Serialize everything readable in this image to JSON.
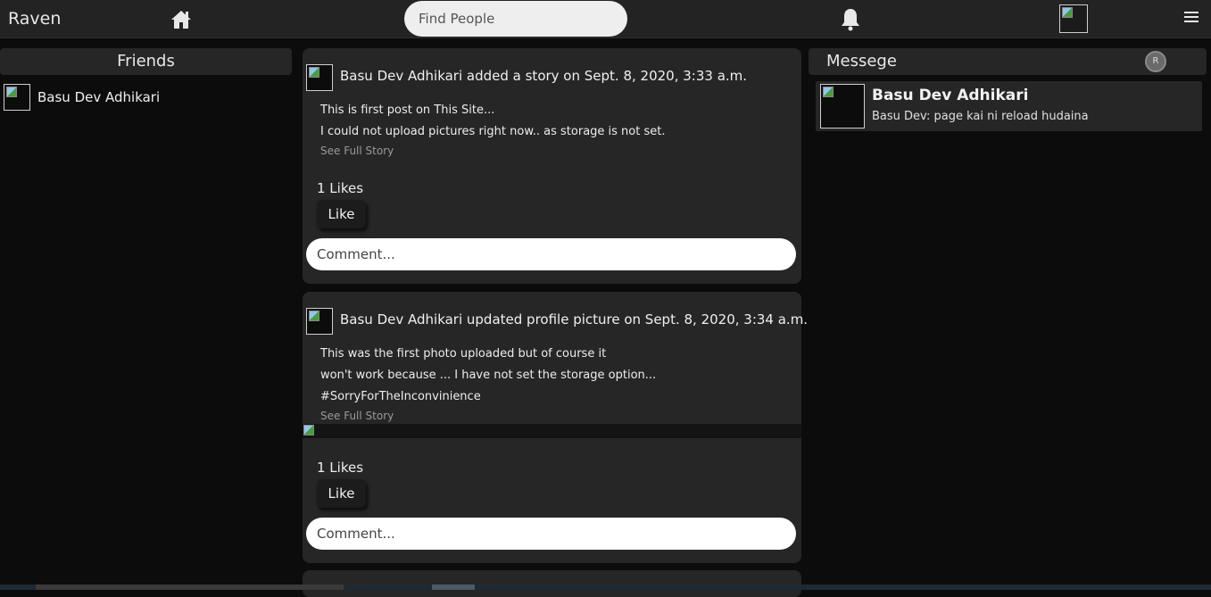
{
  "app": {
    "brand": "Raven"
  },
  "topbar": {
    "search_placeholder": "Find People",
    "icons": [
      "home-icon",
      "bell-icon",
      "menu-icon"
    ]
  },
  "friends": {
    "title": "Friends",
    "items": [
      {
        "name": "Basu Dev Adhikari"
      }
    ]
  },
  "messages": {
    "title": "Messege",
    "items": [
      {
        "name": "Basu Dev Adhikari",
        "preview": "Basu Dev: page kai ni reload hudaina"
      }
    ]
  },
  "posts": [
    {
      "title": "Basu Dev Adhikari added a story on Sept. 8, 2020, 3:33 a.m.",
      "lines": [
        "This is first post on This Site...",
        "I could not upload pictures right now.. as storage is not set."
      ],
      "see_full": "See Full Story",
      "likes": "1 Likes",
      "like_label": "Like",
      "comment_placeholder": "Comment..."
    },
    {
      "title": "Basu Dev Adhikari updated profile picture on Sept. 8, 2020, 3:34 a.m.",
      "lines": [
        "This was the first photo uploaded but of course it",
        "won't work because ... I have not set the storage option...",
        "#SorryForTheInconvinience"
      ],
      "see_full": "See Full Story",
      "likes": "1 Likes",
      "like_label": "Like",
      "comment_placeholder": "Comment..."
    }
  ],
  "colors": {
    "background": "#0c0c0c",
    "panel": "#262626",
    "topbar": "#232323"
  }
}
